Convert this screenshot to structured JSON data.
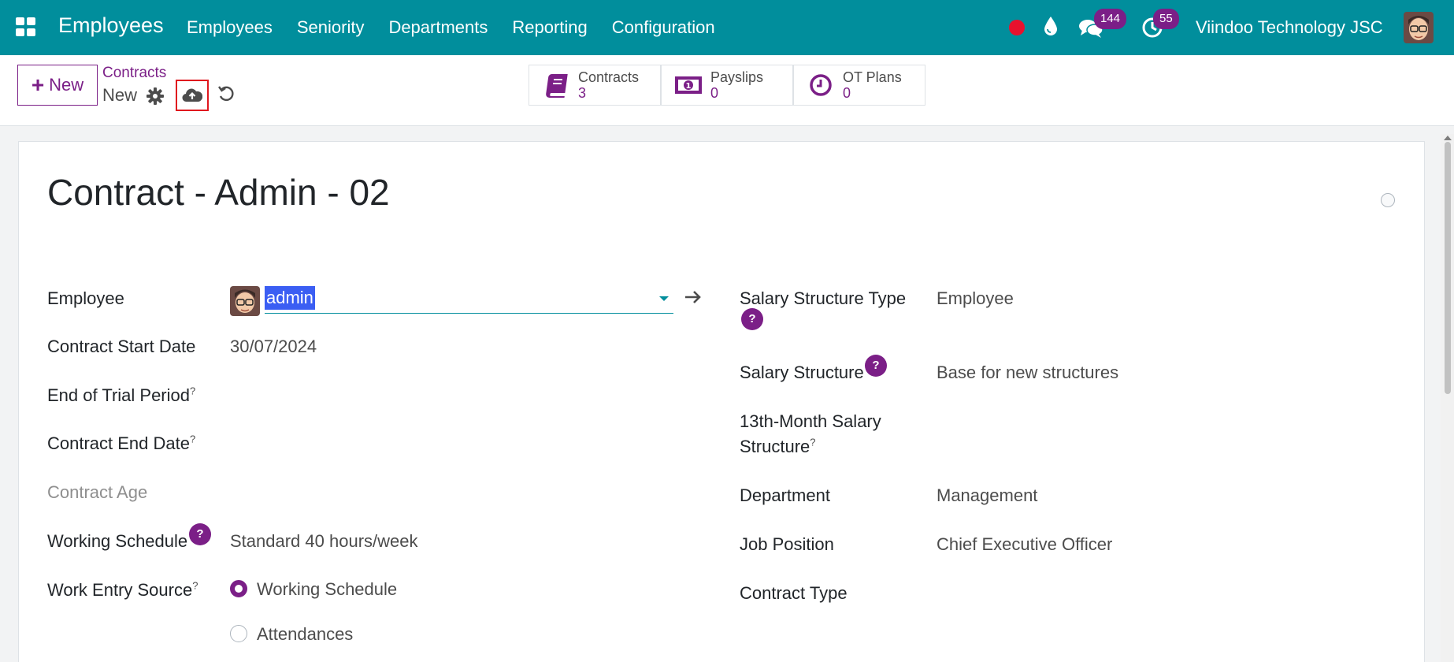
{
  "navbar": {
    "app_title": "Employees",
    "menu": [
      "Employees",
      "Seniority",
      "Departments",
      "Reporting",
      "Configuration"
    ],
    "messages_count": "144",
    "activities_count": "55",
    "company": "Viindoo Technology JSC",
    "accent": "#018e9c"
  },
  "control": {
    "new_label": "New",
    "breadcrumb": "Contracts",
    "record_name": "New"
  },
  "smart_buttons": [
    {
      "label": "Contracts",
      "value": "3",
      "icon": "book-icon"
    },
    {
      "label": "Payslips",
      "value": "0",
      "icon": "money-icon"
    },
    {
      "label": "OT Plans",
      "value": "0",
      "icon": "clock-icon"
    }
  ],
  "form": {
    "title": "Contract - Admin - 02",
    "left": {
      "employee_label": "Employee",
      "employee_value": "admin",
      "start_date_label": "Contract Start Date",
      "start_date_value": "30/07/2024",
      "trial_label": "End of Trial Period",
      "end_date_label": "Contract End Date",
      "age_label": "Contract Age",
      "schedule_label": "Working Schedule",
      "schedule_value": "Standard 40 hours/week",
      "work_entry_label": "Work Entry Source",
      "work_entry_options": [
        "Working Schedule",
        "Attendances"
      ],
      "work_entry_selected": "Working Schedule"
    },
    "right": {
      "structure_type_label": "Salary Structure Type",
      "structure_type_value": "Employee",
      "structure_label": "Salary Structure",
      "structure_value": "Base for new structures",
      "thirteenth_label_line1": "13th-Month Salary",
      "thirteenth_label_line2": "Structure",
      "department_label": "Department",
      "department_value": "Management",
      "job_label": "Job Position",
      "job_value": "Chief Executive Officer",
      "contract_type_label": "Contract Type"
    },
    "help_mark": "?",
    "tooltip_mark": "?"
  },
  "colors": {
    "primary": "#7b1f87",
    "navbar": "#018e9c",
    "highlight": "#e0171e"
  }
}
